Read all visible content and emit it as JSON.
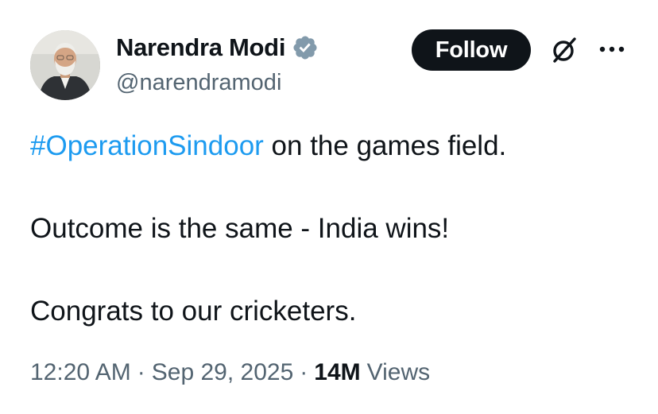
{
  "author": {
    "name": "Narendra Modi",
    "handle": "@narendramodi",
    "verified": true,
    "avatar_icon": "profile-photo"
  },
  "actions": {
    "follow_label": "Follow",
    "grok_icon": "grok-icon",
    "more_icon": "more-horizontal-icon"
  },
  "tweet": {
    "hashtag": "#OperationSindoor",
    "line1_rest": " on the games field.",
    "line2": "Outcome is the same - India wins!",
    "line3": "Congrats to our cricketers."
  },
  "meta": {
    "time": "12:20 AM",
    "separator": "·",
    "date": "Sep 29, 2025",
    "views_count": "14M",
    "views_label": "Views"
  },
  "colors": {
    "link": "#1d9bf0",
    "verified_badge": "#829aab",
    "text": "#0f1419",
    "muted": "#536471"
  }
}
